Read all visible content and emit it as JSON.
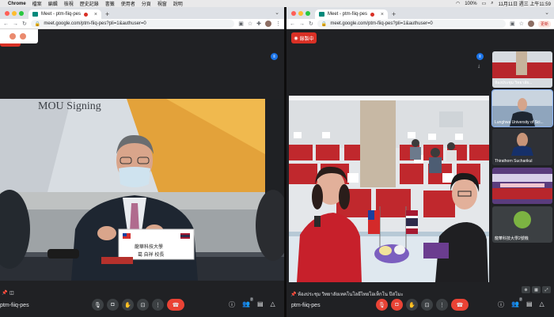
{
  "menubar": {
    "app": "Chrome",
    "items": [
      "檔案",
      "編輯",
      "檢視",
      "歷史記錄",
      "書籤",
      "使用者",
      "分頁",
      "視窗",
      "說明"
    ],
    "battery": "100%",
    "clock": "11月11日 週三 上午11:59"
  },
  "left_window": {
    "tab_title": "Meet - ptm-fiiq-pes",
    "url": "meet.google.com/ptm-fiiq-pes?pli=1&authuser=0",
    "slide_title": "MOU Signing",
    "nameplate_line1": "龍華科技大學",
    "nameplate_line2": "葛 自祥  校長",
    "meeting_code": "ptm-fiiq-pes",
    "participants_badge": "7"
  },
  "right_window": {
    "tab_title": "Meet - ptm-fiiq-pes",
    "url": "meet.google.com/ptm-fiiq-pes?pli=1&authuser=0",
    "update_label": "更新",
    "record_label": "錄製中",
    "caption": "ห้องประชุม วิทยาลัยเทคโนโลยีไทยโอเท็กโน ปีสโมะ",
    "meeting_code": "ptm-fiiq-pes",
    "participants_badge": "7",
    "tiles": [
      {
        "name": "ห้องประชุม วิทยาลัย..."
      },
      {
        "name": "Lunghwa University of Sci..."
      },
      {
        "name": "Thirathorn Sucharikul"
      },
      {
        "name": ""
      },
      {
        "name": "龍華科技大學2號機"
      }
    ]
  },
  "colors": {
    "meet_bg": "#202124",
    "record_red": "#d93025",
    "hang_red": "#ea4335",
    "accent_blue": "#1a73e8"
  }
}
